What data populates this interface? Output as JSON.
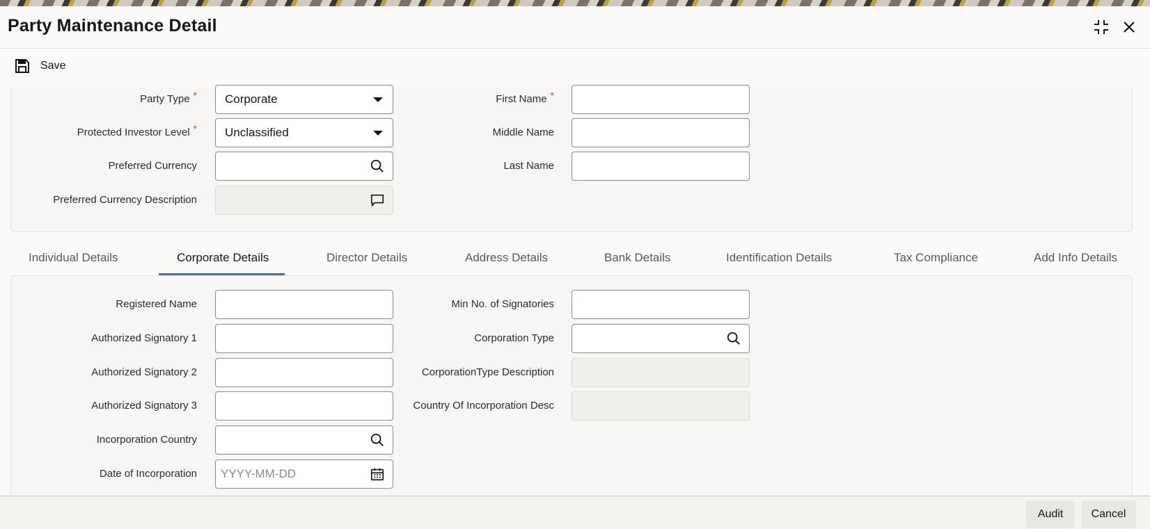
{
  "window": {
    "title": "Party Maintenance Detail",
    "maximize_icon": "maximize-icon",
    "close_icon": "close-icon"
  },
  "toolbar": {
    "save_label": "Save",
    "save_icon": "floppy-disk-icon"
  },
  "header_form": {
    "party_type": {
      "label": "Party Type",
      "required": "*",
      "value": "Corporate"
    },
    "protected_investor_level": {
      "label": "Protected Investor Level",
      "required": "*",
      "value": "Unclassified"
    },
    "preferred_currency": {
      "label": "Preferred Currency",
      "value": ""
    },
    "preferred_currency_description": {
      "label": "Preferred Currency Description",
      "value": ""
    },
    "first_name": {
      "label": "First Name",
      "required": "*",
      "value": ""
    },
    "middle_name": {
      "label": "Middle Name",
      "value": ""
    },
    "last_name": {
      "label": "Last Name",
      "value": ""
    }
  },
  "tabs": [
    {
      "label": "Individual Details"
    },
    {
      "label": "Corporate Details",
      "active": true
    },
    {
      "label": "Director Details"
    },
    {
      "label": "Address Details"
    },
    {
      "label": "Bank Details"
    },
    {
      "label": "Identification Details"
    },
    {
      "label": "Tax Compliance"
    },
    {
      "label": "Add Info Details"
    }
  ],
  "corporate_details": {
    "registered_name": {
      "label": "Registered Name",
      "value": ""
    },
    "authorized_signatory_1": {
      "label": "Authorized Signatory 1",
      "value": ""
    },
    "authorized_signatory_2": {
      "label": "Authorized Signatory 2",
      "value": ""
    },
    "authorized_signatory_3": {
      "label": "Authorized Signatory 3",
      "value": ""
    },
    "incorporation_country": {
      "label": "Incorporation Country",
      "value": ""
    },
    "date_of_incorporation": {
      "label": "Date of Incorporation",
      "placeholder": "YYYY-MM-DD"
    },
    "min_no_of_signatories": {
      "label": "Min No. of Signatories",
      "value": ""
    },
    "corporation_type": {
      "label": "Corporation Type",
      "value": ""
    },
    "corporation_type_description": {
      "label": "CorporationType Description",
      "value": ""
    },
    "country_of_incorporation_desc": {
      "label": "Country Of Incorporation Desc",
      "value": ""
    }
  },
  "footer": {
    "audit_label": "Audit",
    "cancel_label": "Cancel"
  },
  "colors": {
    "accent_underline": "#4f6f8f",
    "required_marker": "#c74634"
  }
}
